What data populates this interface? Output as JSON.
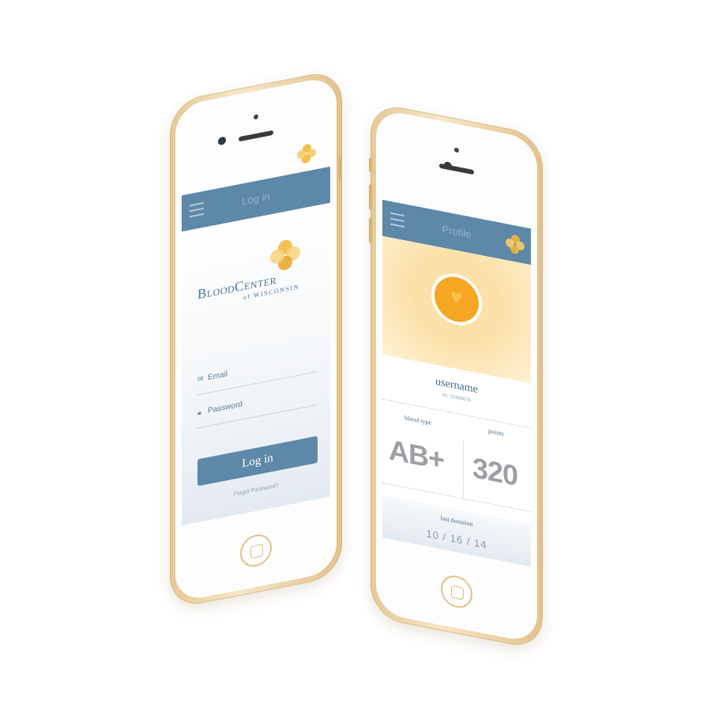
{
  "login_screen": {
    "nav_title": "Log in",
    "brand_line1": "BloodCenter",
    "brand_line2": "of WISCONSIN",
    "email_label": "Email",
    "password_label": "Password",
    "login_button": "Log in",
    "forgot_link": "Forgot Password?"
  },
  "profile_screen": {
    "nav_title": "Profile",
    "username": "username",
    "user_id": "ID: 12345678",
    "blood_type_label": "blood type",
    "blood_type_value": "AB+",
    "points_label": "points",
    "points_value": "320",
    "last_donation_label": "last donation",
    "last_donation_date": "10 / 16 / 14"
  },
  "colors": {
    "brand_blue": "#5d88a8",
    "accent_gold": "#f2b63a",
    "phone_frame": "#e6c995"
  }
}
